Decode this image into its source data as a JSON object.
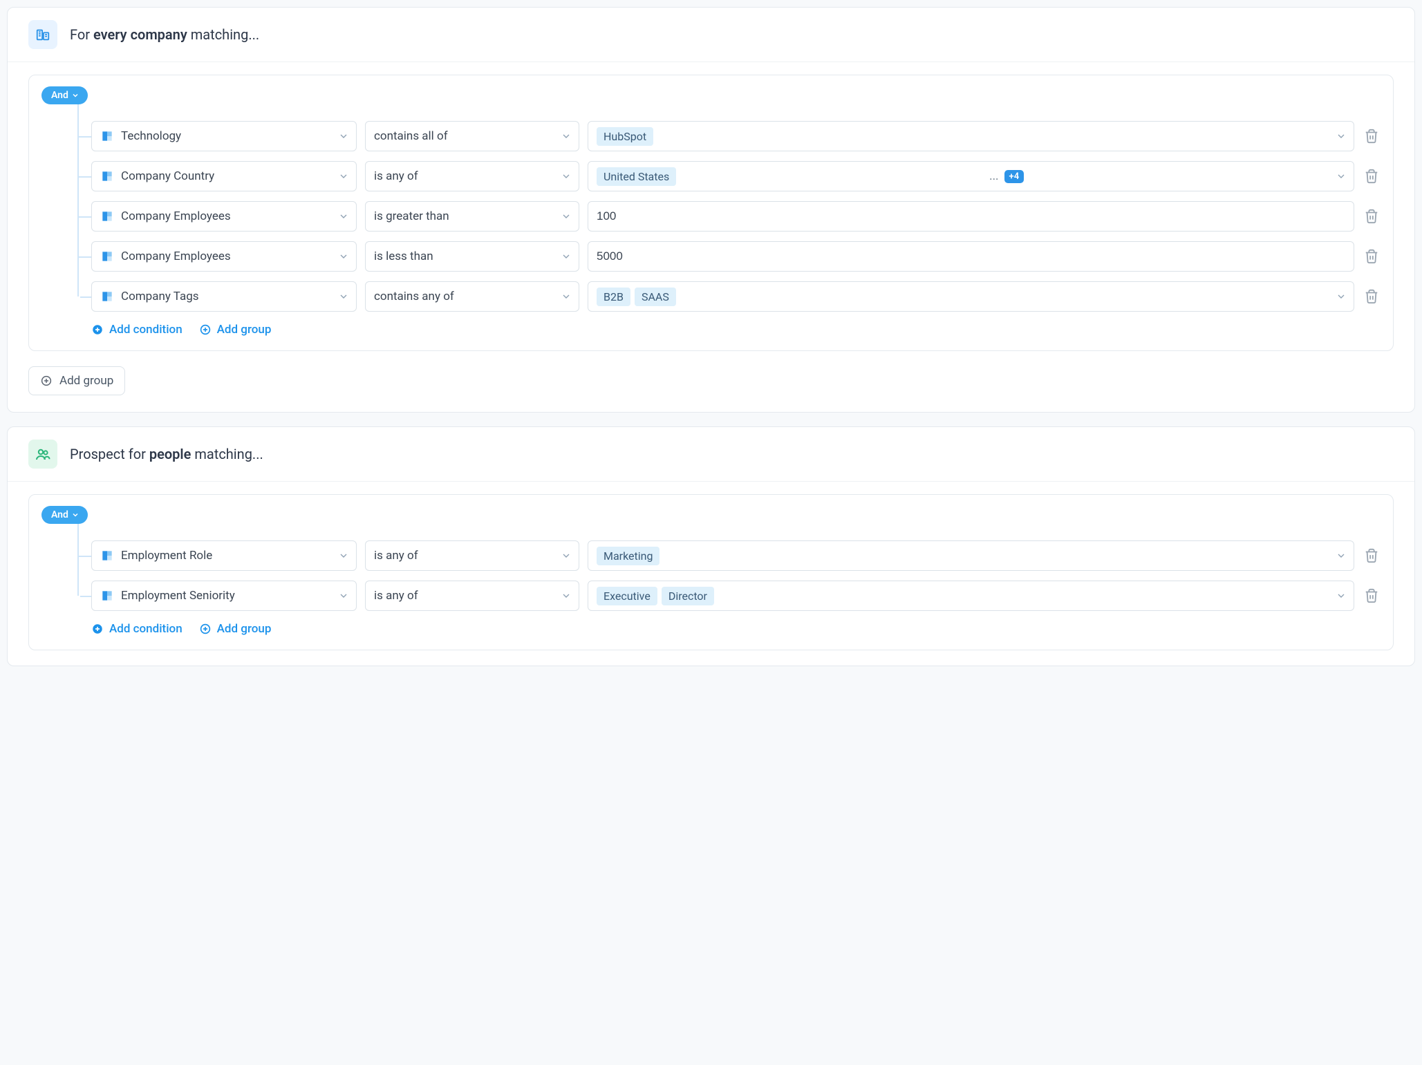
{
  "sections": [
    {
      "id": "company",
      "header_prefix": "For ",
      "header_bold": "every company",
      "header_suffix": " matching...",
      "group_operator": "And",
      "conditions": [
        {
          "field": "Technology",
          "op": "contains all of",
          "value_type": "tags",
          "tags": [
            "HubSpot"
          ]
        },
        {
          "field": "Company Country",
          "op": "is any of",
          "value_type": "tags",
          "tags": [
            "United States"
          ],
          "overflow_count": "+4",
          "show_ellipsis": true
        },
        {
          "field": "Company Employees",
          "op": "is greater than",
          "value_type": "text",
          "text": "100"
        },
        {
          "field": "Company Employees",
          "op": "is less than",
          "value_type": "text",
          "text": "5000"
        },
        {
          "field": "Company Tags",
          "op": "contains any of",
          "value_type": "tags",
          "tags": [
            "B2B",
            "SAAS"
          ]
        }
      ],
      "add_condition_label": "Add condition",
      "add_group_label": "Add group",
      "outer_add_group_label": "Add group"
    },
    {
      "id": "people",
      "header_prefix": "Prospect for ",
      "header_bold": "people",
      "header_suffix": " matching...",
      "group_operator": "And",
      "conditions": [
        {
          "field": "Employment Role",
          "op": "is any of",
          "value_type": "tags",
          "tags": [
            "Marketing"
          ]
        },
        {
          "field": "Employment Seniority",
          "op": "is any of",
          "value_type": "tags",
          "tags": [
            "Executive",
            "Director"
          ]
        }
      ],
      "add_condition_label": "Add condition",
      "add_group_label": "Add group"
    }
  ]
}
